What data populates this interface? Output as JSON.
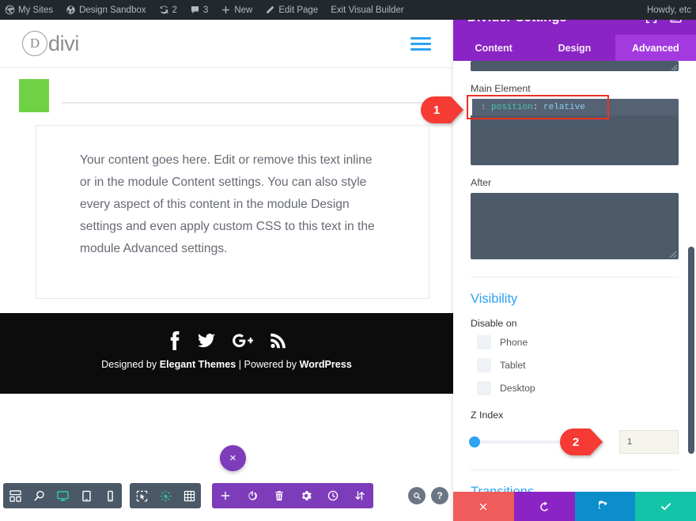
{
  "adminbar": {
    "items": [
      {
        "icon": "wordpress-logo-icon",
        "label": "My Sites"
      },
      {
        "icon": "site-icon",
        "label": "Design Sandbox"
      },
      {
        "icon": "updates-icon",
        "label": "2"
      },
      {
        "icon": "comment-icon",
        "label": "3"
      },
      {
        "icon": "plus-icon",
        "label": "New"
      },
      {
        "icon": "pencil-icon",
        "label": "Edit Page"
      },
      {
        "icon": "",
        "label": "Exit Visual Builder"
      }
    ],
    "howdy": "Howdy, etc"
  },
  "site": {
    "logo_mark": "D",
    "logo_text": "divi",
    "menu_icon": "hamburger-menu-icon",
    "text_module": "Your content goes here. Edit or remove this text inline or in the module Content settings. You can also style every aspect of this content in the module Design settings and even apply custom CSS to this text in the module Advanced settings.",
    "footer": {
      "social": [
        "facebook-icon",
        "twitter-icon",
        "google-plus-icon",
        "rss-icon"
      ],
      "credit_prefix": "Designed by ",
      "credit_brand": "Elegant Themes",
      "credit_mid": " | Powered by ",
      "credit_platform": "WordPress"
    }
  },
  "builder_bar": {
    "close_label": "×",
    "group_view": [
      {
        "icon": "wireframe-view-icon",
        "active": false
      },
      {
        "icon": "zoom-out-view-icon",
        "active": false
      },
      {
        "icon": "desktop-view-icon",
        "active": true
      },
      {
        "icon": "tablet-view-icon",
        "active": false
      },
      {
        "icon": "phone-view-icon",
        "active": false
      }
    ],
    "group_mode": [
      {
        "icon": "click-mode-icon"
      },
      {
        "icon": "hover-mode-icon"
      },
      {
        "icon": "grid-mode-icon"
      }
    ],
    "group_actions": [
      {
        "icon": "add-section-icon"
      },
      {
        "icon": "power-toggle-icon"
      },
      {
        "icon": "trash-icon"
      },
      {
        "icon": "gear-settings-icon"
      },
      {
        "icon": "history-clock-icon"
      },
      {
        "icon": "portability-icon"
      }
    ],
    "helpers": [
      {
        "icon": "search-help-icon"
      },
      {
        "icon": "question-help-icon"
      }
    ]
  },
  "settings": {
    "title": "Divider Settings",
    "header_icons": [
      {
        "icon": "focus-target-icon"
      },
      {
        "icon": "panel-layout-icon"
      }
    ],
    "tabs": [
      {
        "label": "Content",
        "active": false
      },
      {
        "label": "Design",
        "active": false
      },
      {
        "label": "Advanced",
        "active": true
      }
    ],
    "main_element": {
      "label": "Main Element",
      "line_number": "1",
      "property": "position",
      "colon": ":",
      "value": "relative"
    },
    "after": {
      "label": "After",
      "value": ""
    },
    "visibility": {
      "title": "Visibility",
      "disable_label": "Disable on",
      "options": [
        {
          "label": "Phone",
          "checked": false
        },
        {
          "label": "Tablet",
          "checked": false
        },
        {
          "label": "Desktop",
          "checked": false
        }
      ]
    },
    "z_index": {
      "label": "Z Index",
      "value": "1"
    },
    "transitions_title": "Transitions",
    "footer_buttons": [
      {
        "icon": "cancel-x-icon",
        "name": "cancel",
        "color": "#f05b5b"
      },
      {
        "icon": "undo-icon",
        "name": "undo",
        "color": "#8b24c4"
      },
      {
        "icon": "redo-icon",
        "name": "redo",
        "color": "#0c8ecb"
      },
      {
        "icon": "save-check-icon",
        "name": "save",
        "color": "#14c4a9"
      }
    ]
  },
  "callouts": [
    {
      "number": "1",
      "target": "main-element-css-field"
    },
    {
      "number": "2",
      "target": "z-index-field"
    }
  ],
  "colors": {
    "divi_purple": "#8b24c4",
    "divi_purple_active": "#a33ae0",
    "accent_blue": "#2ea3f2",
    "callout_red": "#f63a34",
    "code_bg": "#4c5a6a",
    "green_square": "#6fd244",
    "teal": "#14c4a9"
  }
}
